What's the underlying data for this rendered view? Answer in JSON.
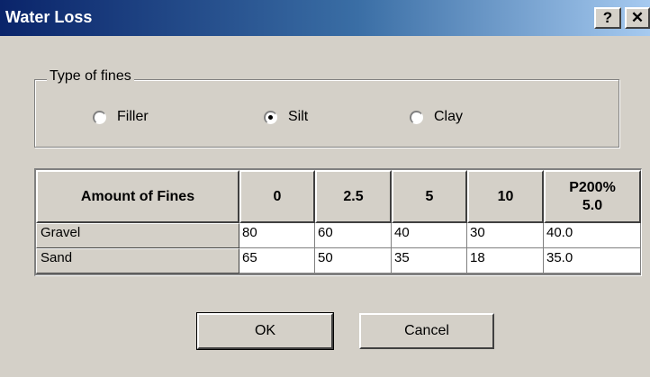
{
  "window": {
    "title": "Water Loss",
    "help_glyph": "?",
    "close_glyph": "✕"
  },
  "fines_group": {
    "legend": "Type of fines",
    "options": [
      {
        "label": "Filler",
        "selected": false
      },
      {
        "label": "Silt",
        "selected": true
      },
      {
        "label": "Clay",
        "selected": false
      }
    ]
  },
  "table": {
    "header": [
      "Amount of Fines",
      "0",
      "2.5",
      "5",
      "10",
      "P200%\n5.0"
    ],
    "header_p200_line1": "P200%",
    "header_p200_line2": "5.0",
    "rows": [
      {
        "label": "Gravel",
        "values": [
          "80",
          "60",
          "40",
          "30",
          "40.0"
        ]
      },
      {
        "label": "Sand",
        "values": [
          "65",
          "50",
          "35",
          "18",
          "35.0"
        ]
      }
    ]
  },
  "buttons": {
    "ok": "OK",
    "cancel": "Cancel"
  }
}
